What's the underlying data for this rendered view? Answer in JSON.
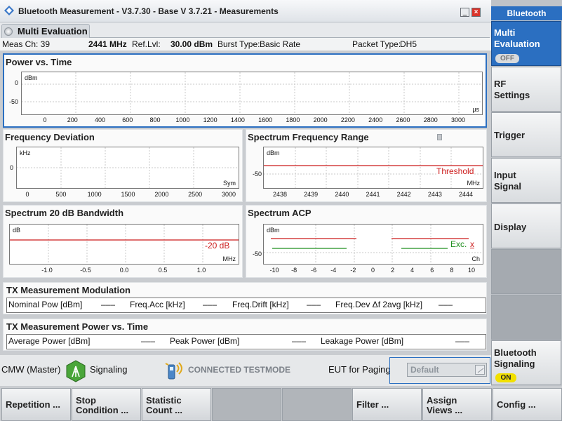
{
  "window": {
    "title": "Bluetooth Measurement  - V3.7.30 - Base V 3.7.21 - Measurements",
    "minimize": "_",
    "close": "×"
  },
  "tab": {
    "label": "Multi Evaluation"
  },
  "info": {
    "meas_ch": "Meas Ch: 39",
    "freq": "2441 MHz",
    "ref_label": "Ref.Lvl:",
    "ref_value": "30.00 dBm",
    "burst_label": "Burst Type:",
    "burst_value": "Basic Rate",
    "packet_label": "Packet Type:",
    "packet_value": "DH5"
  },
  "panels": {
    "power_time": {
      "title": "Power vs. Time",
      "unit": "dBm",
      "xunit": "μs",
      "yticks": [
        "0",
        "-50"
      ],
      "xticks": [
        "0",
        "200",
        "400",
        "600",
        "800",
        "1000",
        "1200",
        "1400",
        "1600",
        "1800",
        "2000",
        "2200",
        "2400",
        "2600",
        "2800",
        "3000"
      ]
    },
    "freq_dev": {
      "title": "Frequency Deviation",
      "unit": "kHz",
      "xunit": "Sym",
      "yticks": [
        "0"
      ],
      "xticks": [
        "0",
        "500",
        "1000",
        "1500",
        "2000",
        "2500",
        "3000"
      ]
    },
    "spec_range": {
      "title": "Spectrum Frequency Range",
      "unit": "dBm",
      "xunit": "MHz",
      "yticks": [
        "-50"
      ],
      "xticks": [
        "2438",
        "2439",
        "2440",
        "2441",
        "2442",
        "2443",
        "2444"
      ],
      "marker": "Threshold"
    },
    "spec_bw": {
      "title": "Spectrum 20 dB Bandwidth",
      "unit": "dB",
      "xunit": "MHz",
      "xticks": [
        "-1.0",
        "-0.5",
        "0.0",
        "0.5",
        "1.0"
      ],
      "marker": "-20 dB"
    },
    "spec_acp": {
      "title": "Spectrum ACP",
      "unit": "dBm",
      "xunit": "Ch",
      "yticks": [
        "-50"
      ],
      "xticks": [
        "-10",
        "-8",
        "-6",
        "-4",
        "-2",
        "0",
        "2",
        "4",
        "6",
        "8",
        "10"
      ],
      "marker": "Exc.",
      "marker_x": "x"
    }
  },
  "modulation": {
    "title": "TX Measurement Modulation",
    "nominal_label": "Nominal Pow [dBm]",
    "nominal_value": "–––",
    "freq_acc_label": "Freq.Acc [kHz]",
    "freq_acc_value": "–––",
    "freq_drift_label": "Freq.Drift [kHz]",
    "freq_drift_value": "–––",
    "freq_dev_label": "Freq.Dev Δf 2avg [kHz]",
    "freq_dev_value": "–––"
  },
  "power": {
    "title": "TX Measurement Power vs. Time",
    "avg_label": "Average Power [dBm]",
    "avg_value": "–––",
    "peak_label": "Peak Power [dBm]",
    "peak_value": "–––",
    "leak_label": "Leakage Power [dBm]",
    "leak_value": "–––"
  },
  "status": {
    "cmw": "CMW (Master)",
    "signaling": "Signaling",
    "connection": "CONNECTED TESTMODE",
    "eut_label": "EUT for Paging",
    "eut_value": "Default"
  },
  "sidebar": {
    "header": "Bluetooth",
    "multi_eval": "Multi\nEvaluation",
    "multi_eval_state": "OFF",
    "rf_settings": "RF\nSettings",
    "trigger": "Trigger",
    "input_signal": "Input\nSignal",
    "display": "Display",
    "bt_signaling": "Bluetooth\nSignaling",
    "bt_signaling_state": "ON"
  },
  "hotkeys": [
    "Repetition ...",
    "Stop\nCondition ...",
    "Statistic\nCount ...",
    "",
    "",
    "Filter ...",
    "Assign\nViews ...",
    "Config ..."
  ],
  "colors": {
    "accent_blue": "#2b6fc1",
    "limit_red": "#cc1b1b",
    "limit_green": "#1f8f1f",
    "on_yellow": "#f2e000"
  }
}
